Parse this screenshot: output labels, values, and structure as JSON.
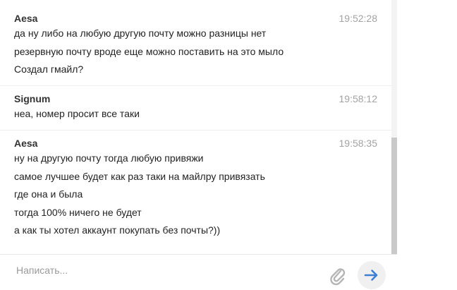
{
  "messages": [
    {
      "author": "Aesa",
      "time": "19:52:28",
      "lines": [
        "да ну либо на любую другую почту можно разницы нет",
        "резервную почту вроде еще можно поставить на это мыло",
        "Создал гмайл?"
      ]
    },
    {
      "author": "Signum",
      "time": "19:58:12",
      "lines": [
        "неа, номер просит все таки"
      ]
    },
    {
      "author": "Aesa",
      "time": "19:58:35",
      "lines": [
        "ну на другую почту тогда любую привяжи",
        "самое лучшее будет как раз таки на майлру привязать",
        "где она и была",
        "тогда 100% ничего не будет",
        "а как ты хотел аккаунт покупать без почты?))"
      ]
    }
  ],
  "composer": {
    "placeholder": "Написать..."
  },
  "icons": {
    "attach": "paperclip-icon",
    "send": "arrow-right-icon"
  },
  "colors": {
    "send_arrow": "#3d7fd4",
    "timestamp": "#a3a3a3"
  }
}
